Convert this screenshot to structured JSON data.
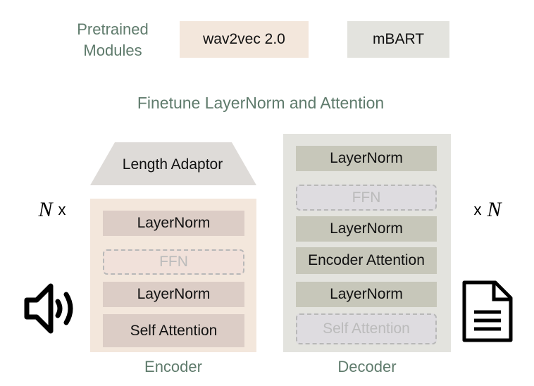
{
  "legend": {
    "title": "Pretrained Modules",
    "wav2vec": "wav2vec 2.0",
    "mbart": "mBART"
  },
  "subtitle": "Finetune LayerNorm and Attention",
  "length_adaptor": "Length Adaptor",
  "encoder": {
    "label": "Encoder",
    "layers": [
      "LayerNorm",
      "FFN",
      "LayerNorm",
      "Self Attention"
    ]
  },
  "decoder": {
    "label": "Decoder",
    "layers": [
      "LayerNorm",
      "FFN",
      "LayerNorm",
      "Encoder Attention",
      "LayerNorm",
      "Self Attention"
    ]
  },
  "repeat_left": {
    "n": "N",
    "x": "x"
  },
  "repeat_right": {
    "n": "N",
    "x": "x"
  },
  "colors": {
    "encoder": "#f3e7dc",
    "decoder": "#e3e3de",
    "text": "#5f7b6c"
  }
}
